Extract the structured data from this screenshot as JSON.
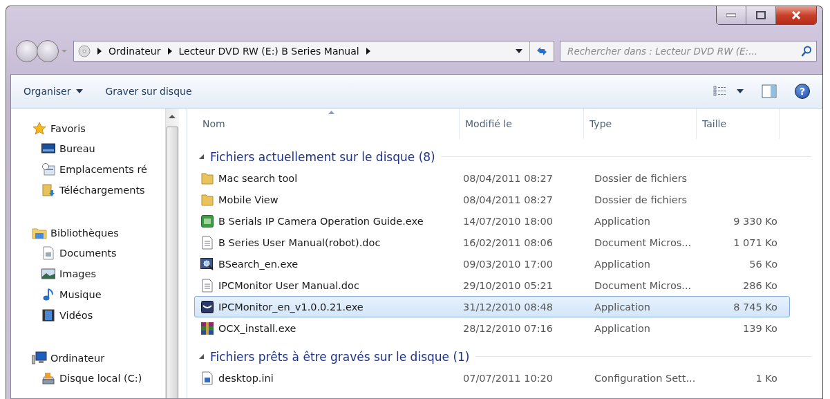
{
  "help": {
    "glyph": "?"
  },
  "address": {
    "breadcrumb": [
      "Ordinateur",
      "Lecteur DVD RW (E:) B Series Manual"
    ]
  },
  "search": {
    "placeholder": "Rechercher dans : Lecteur DVD RW (E:..."
  },
  "toolbar": {
    "items": [
      {
        "label": "Organiser",
        "dropdown": true
      },
      {
        "label": "Graver sur disque",
        "dropdown": false
      }
    ]
  },
  "sidebar": {
    "groups": [
      {
        "label": "Favoris",
        "kind": "star",
        "children": [
          {
            "label": "Bureau",
            "kind": "desktop"
          },
          {
            "label": "Emplacements ré",
            "kind": "recent"
          },
          {
            "label": "Téléchargements",
            "kind": "downloads"
          }
        ]
      },
      {
        "label": "Bibliothèques",
        "kind": "library",
        "children": [
          {
            "label": "Documents",
            "kind": "documents"
          },
          {
            "label": "Images",
            "kind": "images"
          },
          {
            "label": "Musique",
            "kind": "music"
          },
          {
            "label": "Vidéos",
            "kind": "videos"
          }
        ]
      },
      {
        "label": "Ordinateur",
        "kind": "computer",
        "children": [
          {
            "label": "Disque local (C:)",
            "kind": "drive"
          }
        ]
      }
    ]
  },
  "table": {
    "columns": [
      {
        "label": "Nom",
        "sorted": true
      },
      {
        "label": "Modifié le",
        "sorted": false
      },
      {
        "label": "Type",
        "sorted": false
      },
      {
        "label": "Taille",
        "sorted": false
      }
    ],
    "groups": [
      {
        "title": "Fichiers actuellement sur le disque (8)",
        "expanded": true,
        "rows": [
          {
            "name": "Mac search tool",
            "kind": "folder",
            "modified": "08/04/2011 08:27",
            "type": "Dossier de fichiers",
            "selected": false
          },
          {
            "name": "Mobile View",
            "kind": "folder",
            "modified": "08/04/2011 08:27",
            "type": "Dossier de fichiers",
            "selected": false
          },
          {
            "name": "B Serials IP Camera Operation Guide.exe",
            "kind": "cp",
            "modified": "14/07/2010 18:00",
            "type": "Application",
            "size": "9 330 Ko",
            "selected": false
          },
          {
            "name": "B Series User Manual(robot).doc",
            "kind": "doc",
            "modified": "16/02/2011 08:06",
            "type": "Document Micros...",
            "size": "1 071 Ko",
            "selected": false
          },
          {
            "name": "BSearch_en.exe",
            "kind": "search",
            "modified": "09/03/2010 17:00",
            "type": "Application",
            "size": "56 Ko",
            "selected": false
          },
          {
            "name": "IPCMonitor User Manual.doc",
            "kind": "doc",
            "modified": "29/10/2010 05:21",
            "type": "Document Micros...",
            "size": "286 Ko",
            "selected": false
          },
          {
            "name": "IPCMonitor_en_v1.0.0.21.exe",
            "kind": "monitor",
            "modified": "31/12/2010 08:48",
            "type": "Application",
            "size": "8 745 Ko",
            "selected": true
          },
          {
            "name": "OCX_install.exe",
            "kind": "installer",
            "modified": "28/12/2010 07:16",
            "type": "Application",
            "size": "139 Ko",
            "selected": false
          }
        ]
      },
      {
        "title": "Fichiers prêts à être gravés sur le disque (1)",
        "expanded": true,
        "rows": [
          {
            "name": "desktop.ini",
            "kind": "ini",
            "modified": "07/07/2011 10:20",
            "type": "Configuration Sett...",
            "size": "1 Ko",
            "selected": false
          }
        ]
      }
    ]
  }
}
